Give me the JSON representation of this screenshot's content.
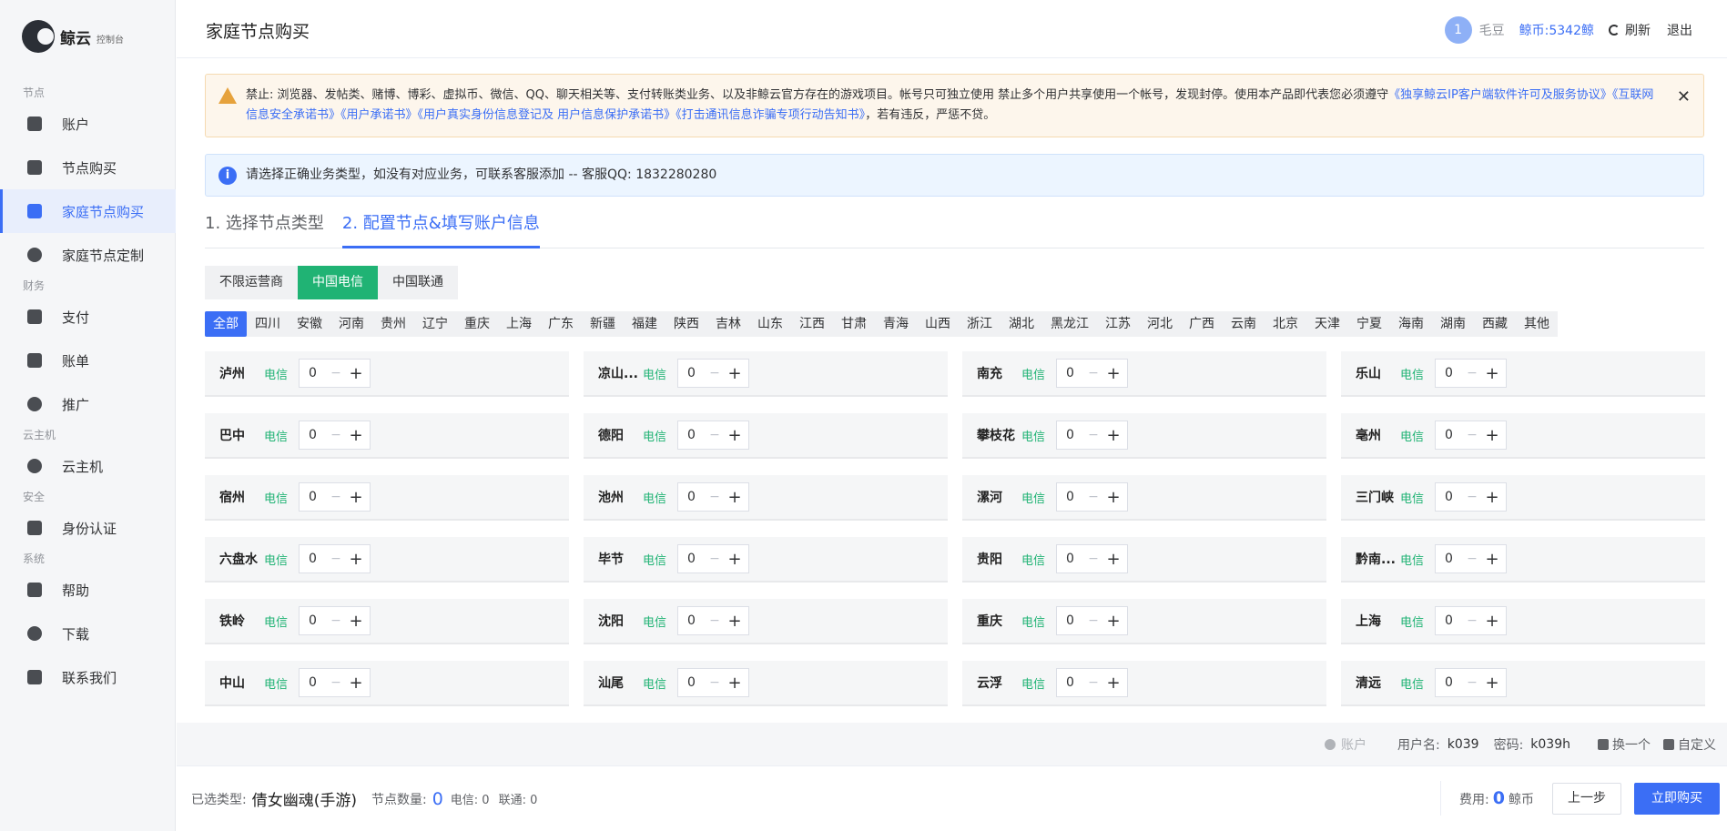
{
  "logo": {
    "name": "鲸云",
    "sub": "控制台"
  },
  "nav": [
    {
      "group": "节点",
      "items": [
        {
          "label": "账户",
          "icon": "user-card-icon"
        },
        {
          "label": "节点购买",
          "icon": "node-icon"
        },
        {
          "label": "家庭节点购买",
          "icon": "home-node-icon",
          "active": true
        },
        {
          "label": "家庭节点定制",
          "icon": "wrench-icon"
        }
      ]
    },
    {
      "group": "财务",
      "items": [
        {
          "label": "支付",
          "icon": "wallet-icon"
        },
        {
          "label": "账单",
          "icon": "bill-icon"
        },
        {
          "label": "推广",
          "icon": "smile-icon"
        }
      ]
    },
    {
      "group": "云主机",
      "items": [
        {
          "label": "云主机",
          "icon": "cloud-icon"
        }
      ]
    },
    {
      "group": "安全",
      "items": [
        {
          "label": "身份认证",
          "icon": "shield-icon"
        }
      ]
    },
    {
      "group": "系统",
      "items": [
        {
          "label": "帮助",
          "icon": "help-icon"
        },
        {
          "label": "下载",
          "icon": "download-icon"
        },
        {
          "label": "联系我们",
          "icon": "headset-icon"
        }
      ]
    }
  ],
  "header": {
    "title": "家庭节点购买",
    "avatar": "1",
    "username": "毛豆",
    "coins": "鲸币:5342鲸",
    "refresh": "刷新",
    "logout": "退出"
  },
  "warning": {
    "text": "禁止: 浏览器、发帖类、赌博、博彩、虚拟币、微信、QQ、聊天相关等、支付转账类业务、以及非鲸云官方存在的游戏项目。帐号只可独立使用 禁止多个用户共享使用一个帐号，发现封停。使用本产品即代表您必须遵守",
    "links": [
      "《独享鲸云IP客户端软件许可及服务协议》",
      "《互联网信息安全承诺书》",
      "《用户承诺书》",
      "《用户真实身份信息登记及 用户信息保护承诺书》",
      "《打击通讯信息诈骗专项行动告知书》"
    ],
    "tail": "，若有违反，严惩不贷。"
  },
  "info": {
    "icon": "i",
    "text": "请选择正确业务类型，如没有对应业务，可联系客服添加 -- 客服QQ: 1832280280"
  },
  "steps": [
    {
      "label": "1. 选择节点类型"
    },
    {
      "label": "2. 配置节点&填写账户信息",
      "active": true
    }
  ],
  "isps": [
    {
      "label": "不限运营商"
    },
    {
      "label": "中国电信",
      "active": true
    },
    {
      "label": "中国联通"
    }
  ],
  "regions": [
    "全部",
    "四川",
    "安徽",
    "河南",
    "贵州",
    "辽宁",
    "重庆",
    "上海",
    "广东",
    "新疆",
    "福建",
    "陕西",
    "吉林",
    "山东",
    "江西",
    "甘肃",
    "青海",
    "山西",
    "浙江",
    "湖北",
    "黑龙江",
    "江苏",
    "河北",
    "广西",
    "云南",
    "北京",
    "天津",
    "宁夏",
    "海南",
    "湖南",
    "西藏",
    "其他"
  ],
  "nodes": [
    {
      "city": "泸州",
      "carrier": "电信",
      "qty": "0"
    },
    {
      "city": "凉山...",
      "carrier": "电信",
      "qty": "0"
    },
    {
      "city": "南充",
      "carrier": "电信",
      "qty": "0"
    },
    {
      "city": "乐山",
      "carrier": "电信",
      "qty": "0"
    },
    {
      "city": "巴中",
      "carrier": "电信",
      "qty": "0"
    },
    {
      "city": "德阳",
      "carrier": "电信",
      "qty": "0"
    },
    {
      "city": "攀枝花",
      "carrier": "电信",
      "qty": "0"
    },
    {
      "city": "亳州",
      "carrier": "电信",
      "qty": "0"
    },
    {
      "city": "宿州",
      "carrier": "电信",
      "qty": "0"
    },
    {
      "city": "池州",
      "carrier": "电信",
      "qty": "0"
    },
    {
      "city": "漯河",
      "carrier": "电信",
      "qty": "0"
    },
    {
      "city": "三门峡",
      "carrier": "电信",
      "qty": "0"
    },
    {
      "city": "六盘水",
      "carrier": "电信",
      "qty": "0"
    },
    {
      "city": "毕节",
      "carrier": "电信",
      "qty": "0"
    },
    {
      "city": "贵阳",
      "carrier": "电信",
      "qty": "0"
    },
    {
      "city": "黔南...",
      "carrier": "电信",
      "qty": "0"
    },
    {
      "city": "铁岭",
      "carrier": "电信",
      "qty": "0"
    },
    {
      "city": "沈阳",
      "carrier": "电信",
      "qty": "0"
    },
    {
      "city": "重庆",
      "carrier": "电信",
      "qty": "0"
    },
    {
      "city": "上海",
      "carrier": "电信",
      "qty": "0"
    },
    {
      "city": "中山",
      "carrier": "电信",
      "qty": "0"
    },
    {
      "city": "汕尾",
      "carrier": "电信",
      "qty": "0"
    },
    {
      "city": "云浮",
      "carrier": "电信",
      "qty": "0"
    },
    {
      "city": "清远",
      "carrier": "电信",
      "qty": "0"
    }
  ],
  "stepper": {
    "minus": "−",
    "plus": "+"
  },
  "account": {
    "label": "账户",
    "user_label": "用户名:",
    "user": "k039",
    "pass_label": "密码:",
    "pass": "k039h",
    "swap": "换一个",
    "custom": "自定义"
  },
  "footer": {
    "type_label": "已选类型:",
    "type": "倩女幽魂(手游)",
    "count_label": "节点数量:",
    "count": "0",
    "telecom": "电信: 0",
    "unicom": "联通: 0",
    "fee_label": "费用:",
    "fee": "0",
    "fee_unit": "鲸币",
    "prev": "上一步",
    "buy": "立即购买"
  }
}
